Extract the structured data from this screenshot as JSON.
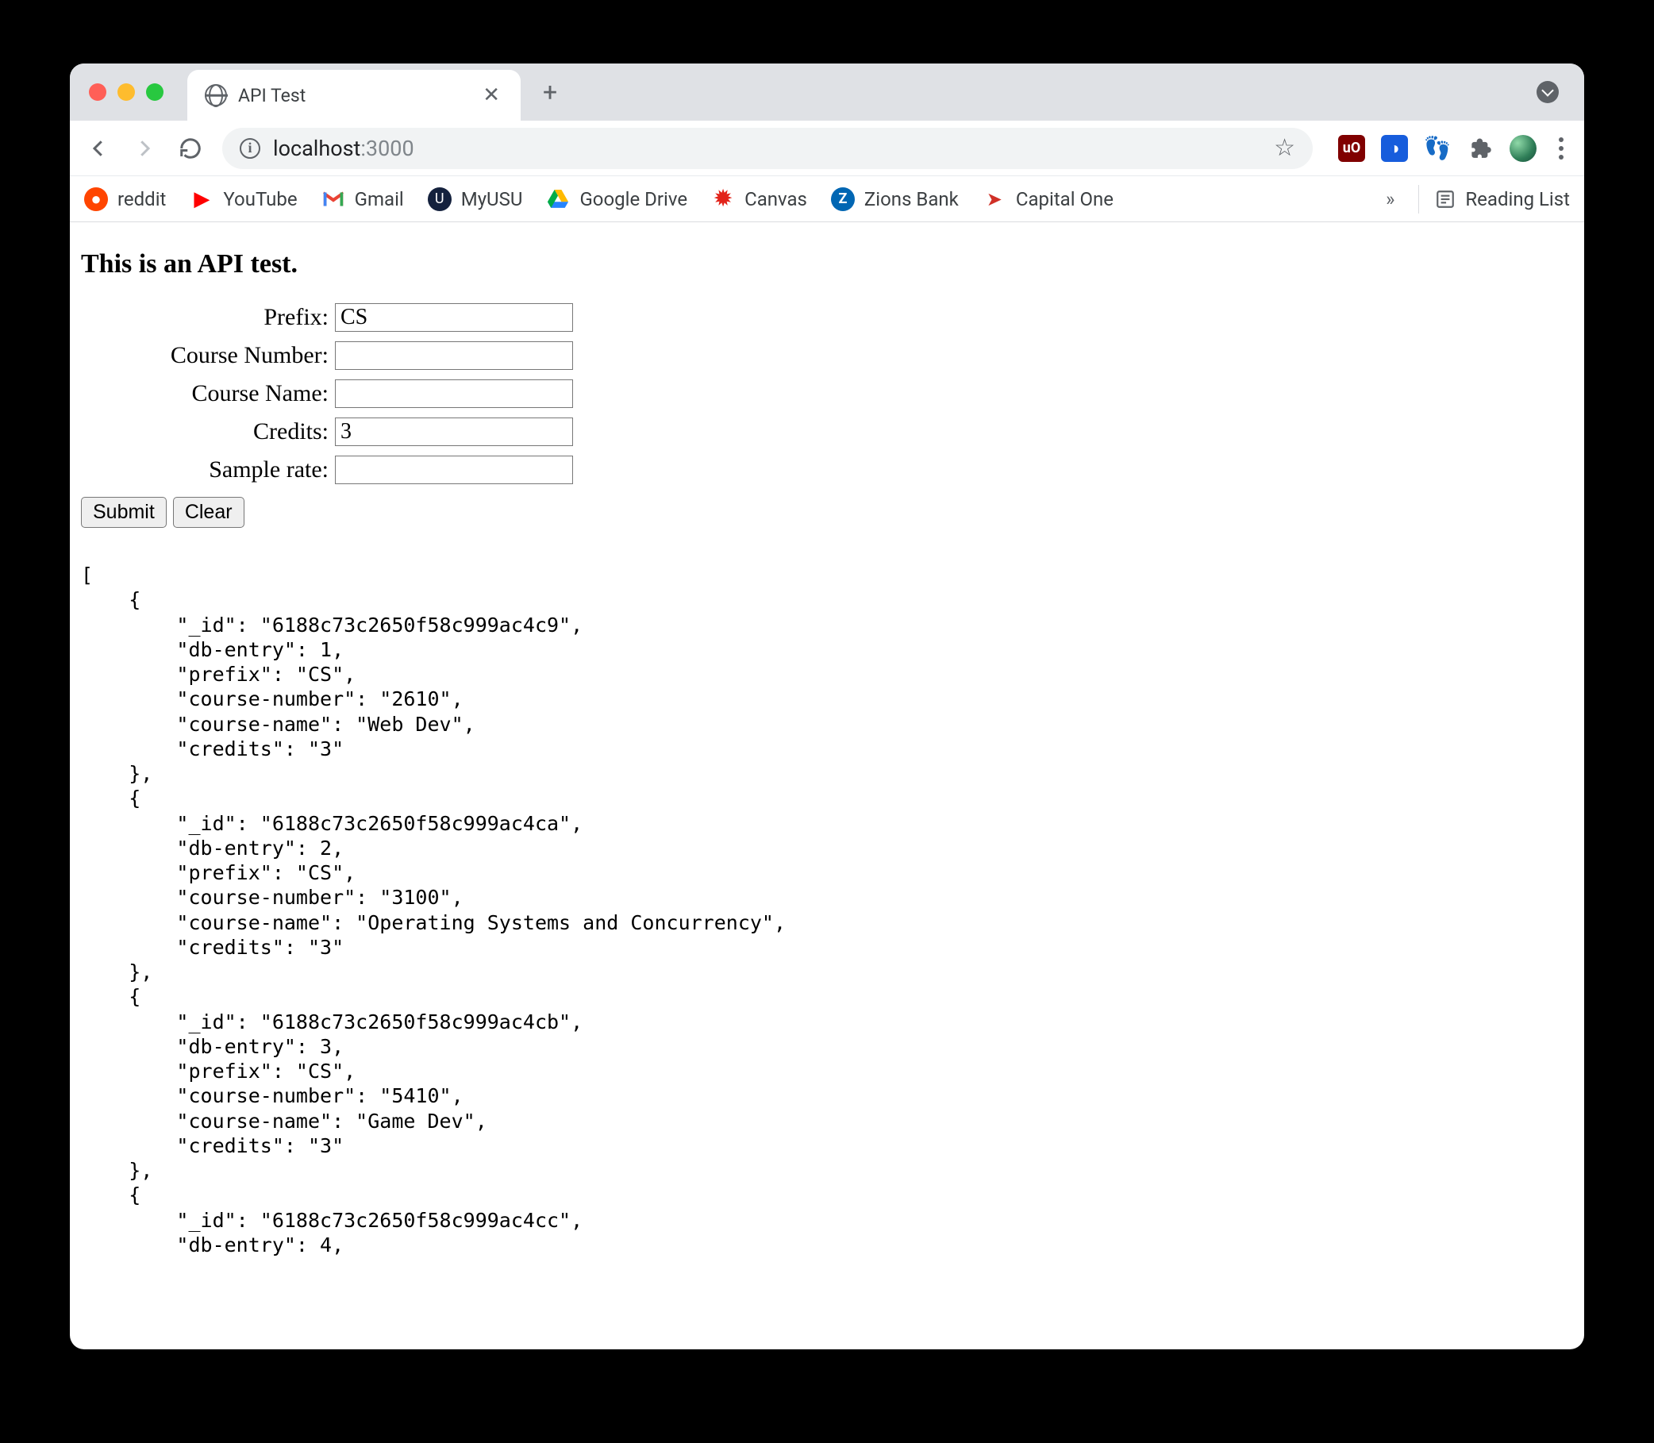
{
  "browser": {
    "tab_title": "API Test",
    "url_host": "localhost",
    "url_port": ":3000"
  },
  "bookmarks": {
    "reddit": "reddit",
    "youtube": "YouTube",
    "gmail": "Gmail",
    "myusu": "MyUSU",
    "gdrive": "Google Drive",
    "canvas": "Canvas",
    "zions": "Zions Bank",
    "capone": "Capital One",
    "overflow": "»",
    "reading_list": "Reading List"
  },
  "page": {
    "heading": "This is an API test."
  },
  "form": {
    "prefix": {
      "label": "Prefix:",
      "value": "CS"
    },
    "course_number": {
      "label": "Course Number:",
      "value": ""
    },
    "course_name": {
      "label": "Course Name:",
      "value": ""
    },
    "credits": {
      "label": "Credits:",
      "value": "3"
    },
    "sample_rate": {
      "label": "Sample rate:",
      "value": ""
    },
    "submit": "Submit",
    "clear": "Clear"
  },
  "response_text": "[\n    {\n        \"_id\": \"6188c73c2650f58c999ac4c9\",\n        \"db-entry\": 1,\n        \"prefix\": \"CS\",\n        \"course-number\": \"2610\",\n        \"course-name\": \"Web Dev\",\n        \"credits\": \"3\"\n    },\n    {\n        \"_id\": \"6188c73c2650f58c999ac4ca\",\n        \"db-entry\": 2,\n        \"prefix\": \"CS\",\n        \"course-number\": \"3100\",\n        \"course-name\": \"Operating Systems and Concurrency\",\n        \"credits\": \"3\"\n    },\n    {\n        \"_id\": \"6188c73c2650f58c999ac4cb\",\n        \"db-entry\": 3,\n        \"prefix\": \"CS\",\n        \"course-number\": \"5410\",\n        \"course-name\": \"Game Dev\",\n        \"credits\": \"3\"\n    },\n    {\n        \"_id\": \"6188c73c2650f58c999ac4cc\",\n        \"db-entry\": 4,"
}
